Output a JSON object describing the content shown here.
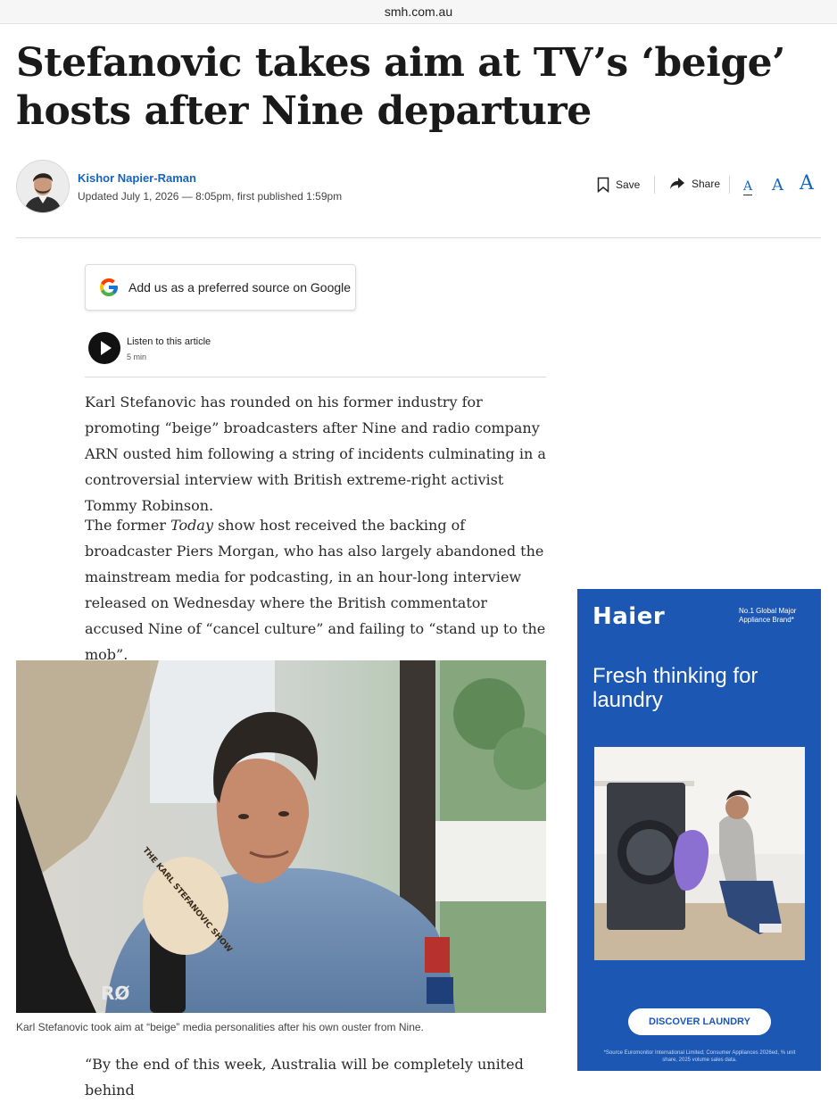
{
  "browser": {
    "url": "smh.com.au"
  },
  "article": {
    "headline": "Stefanovic takes aim at TV’s ‘beige’ hosts after Nine departure",
    "author": "Kishor Napier-Raman",
    "date_line": "Updated July 1, 2026 — 8:05pm, first published 1:59pm",
    "tools": {
      "save": "Save",
      "share": "Share",
      "font_small": "A",
      "font_medium": "A",
      "font_large": "A"
    },
    "google_source": "Add us as a preferred source on Google",
    "listen": {
      "title": "Listen to this article",
      "duration": "5 min"
    },
    "paragraphs": {
      "p1": "Karl Stefanovic has rounded on his former industry for promoting “beige” broadcasters after Nine and radio company ARN ousted him following a string of incidents culminating in a controversial interview with British extreme-right activist Tommy Robinson.",
      "p2_before": "The former ",
      "p2_italic": "Today",
      "p2_after": " show host received the backing of broadcaster Piers Morgan, who has also largely abandoned the mainstream media for podcasting, in an hour-long interview released on Wednesday where the British commentator accused Nine of “cancel culture” and failing to “stand up to the mob”.",
      "p3": "“By the end of this week, Australia will be completely united behind"
    },
    "hero_caption": "Karl Stefanovic took aim at “beige” media personalities after his own ouster from Nine.",
    "mic_text": "THE KARL STEFANOVIC SHOW"
  },
  "ad": {
    "brand": "Haier",
    "tagline": "No.1 Global Major Appliance Brand*",
    "headline": "Fresh thinking for laundry",
    "cta": "DISCOVER LAUNDRY",
    "fine_print": "*Source Euromonitor International Limited; Consumer Appliances 2026ed, % unit share, 2025 volume sales data.",
    "bg_color": "#1b57b3"
  },
  "icons": [
    "bookmark-icon",
    "share-arrow-icon",
    "google-g-icon",
    "play-icon"
  ]
}
